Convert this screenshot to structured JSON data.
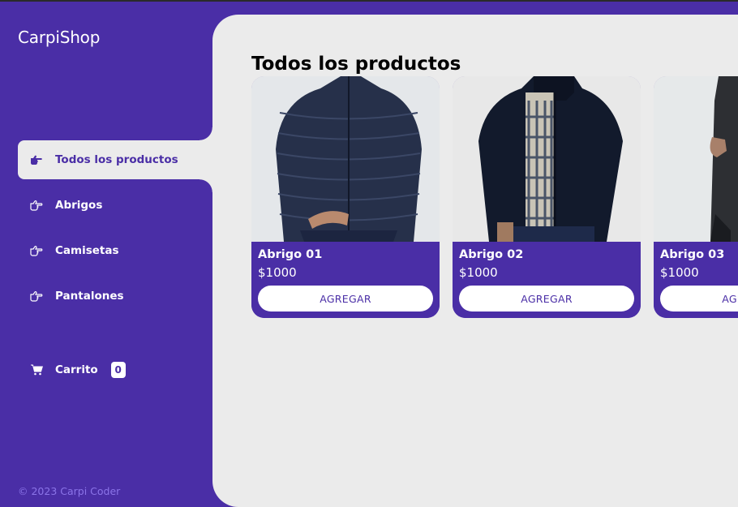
{
  "brand": {
    "name": "CarpiShop"
  },
  "sidebar": {
    "items": [
      {
        "label": "Todos los productos",
        "icon": "hand-pointing-right-icon",
        "active": true
      },
      {
        "label": "Abrigos",
        "icon": "hand-pointing-right-outline-icon",
        "active": false
      },
      {
        "label": "Camisetas",
        "icon": "hand-pointing-right-outline-icon",
        "active": false
      },
      {
        "label": "Pantalones",
        "icon": "hand-pointing-right-outline-icon",
        "active": false
      }
    ],
    "cart": {
      "label": "Carrito",
      "count": "0",
      "icon": "cart-icon"
    },
    "footer": "© 2023 Carpi Coder"
  },
  "main": {
    "title": "Todos los productos",
    "products": [
      {
        "name": "Abrigo 01",
        "price": "$1000",
        "button": "AGREGAR"
      },
      {
        "name": "Abrigo 02",
        "price": "$1000",
        "button": "AGREGAR"
      },
      {
        "name": "Abrigo 03",
        "price": "$1000",
        "button": "AGREGAR"
      }
    ]
  },
  "colors": {
    "primary": "#4a2ea6",
    "background": "#ebebeb",
    "footer_text": "#8b74e8"
  }
}
